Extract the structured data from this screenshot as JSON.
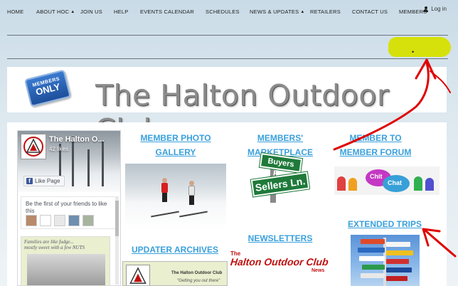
{
  "header": {
    "login_label": "Log in"
  },
  "nav": {
    "items": [
      {
        "label": "HOME",
        "caret": ""
      },
      {
        "label": "ABOUT HOC",
        "caret": "▲"
      },
      {
        "label": "JOIN US",
        "caret": ""
      },
      {
        "label": "HELP",
        "caret": ""
      },
      {
        "label": "EVENTS CALENDAR",
        "caret": ""
      },
      {
        "label": "SCHEDULES",
        "caret": ""
      },
      {
        "label": "NEWS & UPDATES",
        "caret": "▲"
      },
      {
        "label": "RETAILERS",
        "caret": ""
      },
      {
        "label": "CONTACT US",
        "caret": ""
      },
      {
        "label": "MEMBERS",
        "caret": ""
      }
    ],
    "active_marker": "•"
  },
  "banner": {
    "badge_line1": "MEMBERS",
    "badge_line2": "ONLY",
    "title": "The Halton Outdoor Club"
  },
  "facebook": {
    "page_name": "The Halton O...",
    "likes": "42 likes",
    "like_button": "Like Page",
    "f_glyph": "f",
    "friends_text": "Be the first of your friends to like this",
    "post_text_1": "Families are like fudge...",
    "post_text_2": "mostly sweet with a few NUTS"
  },
  "links": {
    "photo_gallery": "MEMBER PHOTO GALLERY",
    "marketplace": "MEMBERS' MARKETPLACE",
    "forum": "MEMBER TO MEMBER FORUM",
    "newsletters": "NEWSLETTERS",
    "updater_archives": "UPDATER ARCHIVES",
    "extended_trips": "EXTENDED TRIPS"
  },
  "images": {
    "sign_top": "Buyers Rd.",
    "sign_bottom": "Sellers Ln.",
    "chit": "Chit",
    "chat": "Chat",
    "newsletter_the": "The",
    "newsletter_main": "Halton Outdoor Club",
    "newsletter_news": "News",
    "updater_title": "The Halton Outdoor Club",
    "updater_sub": "\"Getting you out there\""
  },
  "colors": {
    "link": "#3aa0dc",
    "highlight": "#d6e000",
    "annotation": "#e00000",
    "sign_green": "#1f7a3a",
    "newsletter_red": "#c01010"
  }
}
